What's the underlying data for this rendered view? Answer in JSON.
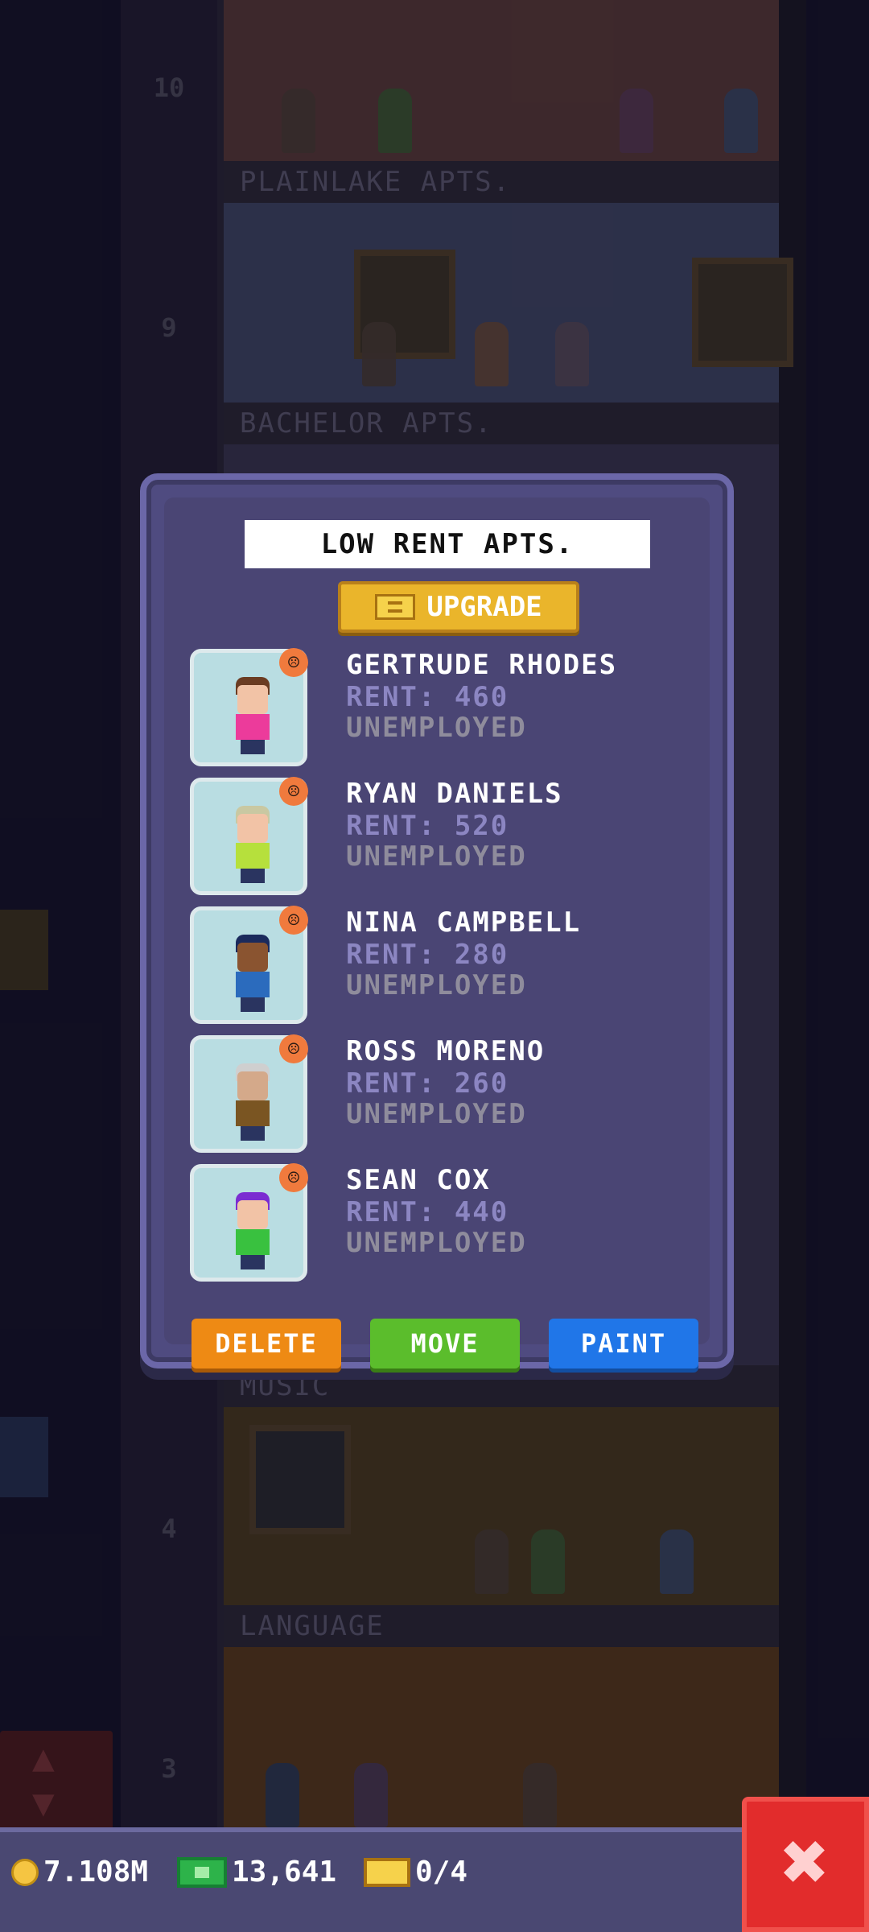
{
  "background": {
    "floors": [
      {
        "number": "10",
        "sign": "PLAINLAKE APTS."
      },
      {
        "number": "9",
        "sign": "BACHELOR APTS."
      },
      {
        "number": "4",
        "sign": "MUSIC"
      },
      {
        "number": "3",
        "sign": "LANGUAGE"
      }
    ]
  },
  "modal": {
    "title": "LOW RENT APTS.",
    "upgrade_label": "UPGRADE",
    "tenants": [
      {
        "name": "GERTRUDE RHODES",
        "rent": "RENT: 460",
        "job": "UNEMPLOYED",
        "hair": "#6b3c22",
        "skin": "#f2c3a6",
        "shirt": "#ec3b9b",
        "mood": "unhappy-face-icon"
      },
      {
        "name": "RYAN DANIELS",
        "rent": "RENT: 520",
        "job": "UNEMPLOYED",
        "hair": "#c9c8a2",
        "skin": "#f2c3a6",
        "shirt": "#b6e03c",
        "mood": "unhappy-face-icon"
      },
      {
        "name": "NINA CAMPBELL",
        "rent": "RENT: 280",
        "job": "UNEMPLOYED",
        "hair": "#1b2a5c",
        "skin": "#8a5430",
        "shirt": "#2b6bbd",
        "mood": "unhappy-face-icon"
      },
      {
        "name": "ROSS MORENO",
        "rent": "RENT: 260",
        "job": "UNEMPLOYED",
        "hair": "#cfcfcf",
        "skin": "#d4a98a",
        "shirt": "#7a5522",
        "mood": "unhappy-face-icon"
      },
      {
        "name": "SEAN COX",
        "rent": "RENT: 440",
        "job": "UNEMPLOYED",
        "hair": "#7b2cd1",
        "skin": "#f2c3a6",
        "shirt": "#39c13f",
        "mood": "unhappy-face-icon"
      }
    ],
    "buttons": {
      "delete": "DELETE",
      "move": "MOVE",
      "paint": "PAINT"
    }
  },
  "status": {
    "coins": "7.108M",
    "bux": "13,641",
    "tickets": "0/4"
  },
  "close_label": "✖"
}
